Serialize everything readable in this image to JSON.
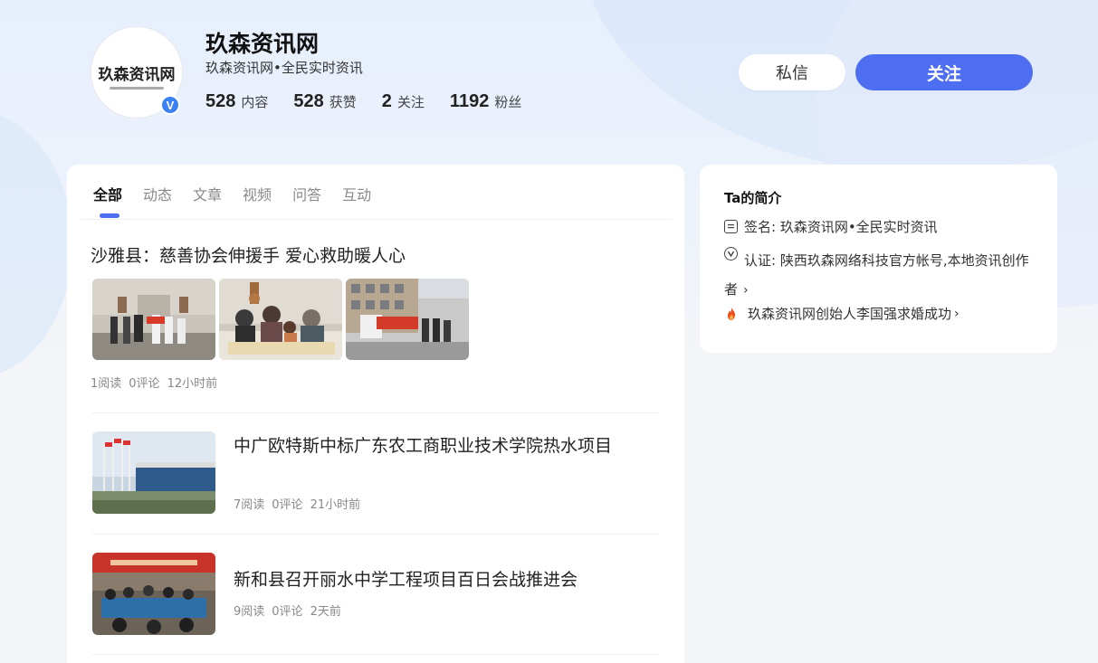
{
  "profile": {
    "name": "玖森资讯网",
    "avatar_text": "玖森资讯网",
    "verified_mark": "V",
    "description": "玖森资讯网•全民实时资讯",
    "stats": [
      {
        "num": "528",
        "label": "内容"
      },
      {
        "num": "528",
        "label": "获赞"
      },
      {
        "num": "2",
        "label": "关注"
      },
      {
        "num": "1192",
        "label": "粉丝"
      }
    ]
  },
  "actions": {
    "message_label": "私信",
    "follow_label": "关注"
  },
  "tabs": [
    {
      "label": "全部",
      "active": true
    },
    {
      "label": "动态"
    },
    {
      "label": "文章"
    },
    {
      "label": "视频"
    },
    {
      "label": "问答"
    },
    {
      "label": "互动"
    }
  ],
  "feed": [
    {
      "title": "沙雅县：慈善协会伸援手 爱心救助暖人心",
      "reads": "1阅读",
      "comments": "0评论",
      "time": "12小时前"
    },
    {
      "title": "中广欧特斯中标广东农工商职业技术学院热水项目",
      "reads": "7阅读",
      "comments": "0评论",
      "time": "21小时前"
    },
    {
      "title": "新和县召开丽水中学工程项目百日会战推进会",
      "reads": "9阅读",
      "comments": "0评论",
      "time": "2天前"
    }
  ],
  "intro": {
    "title": "Ta的简介",
    "signature_label": "签名: 玖森资讯网•全民实时资讯",
    "auth_text": "认证: 陕西玖森网络科技官方帐号,本地资讯创作者",
    "hot_link": "玖森资讯网创始人李国强求婚成功"
  },
  "colors": {
    "accent": "#4e6ef2",
    "badge": "#3b82f6"
  }
}
